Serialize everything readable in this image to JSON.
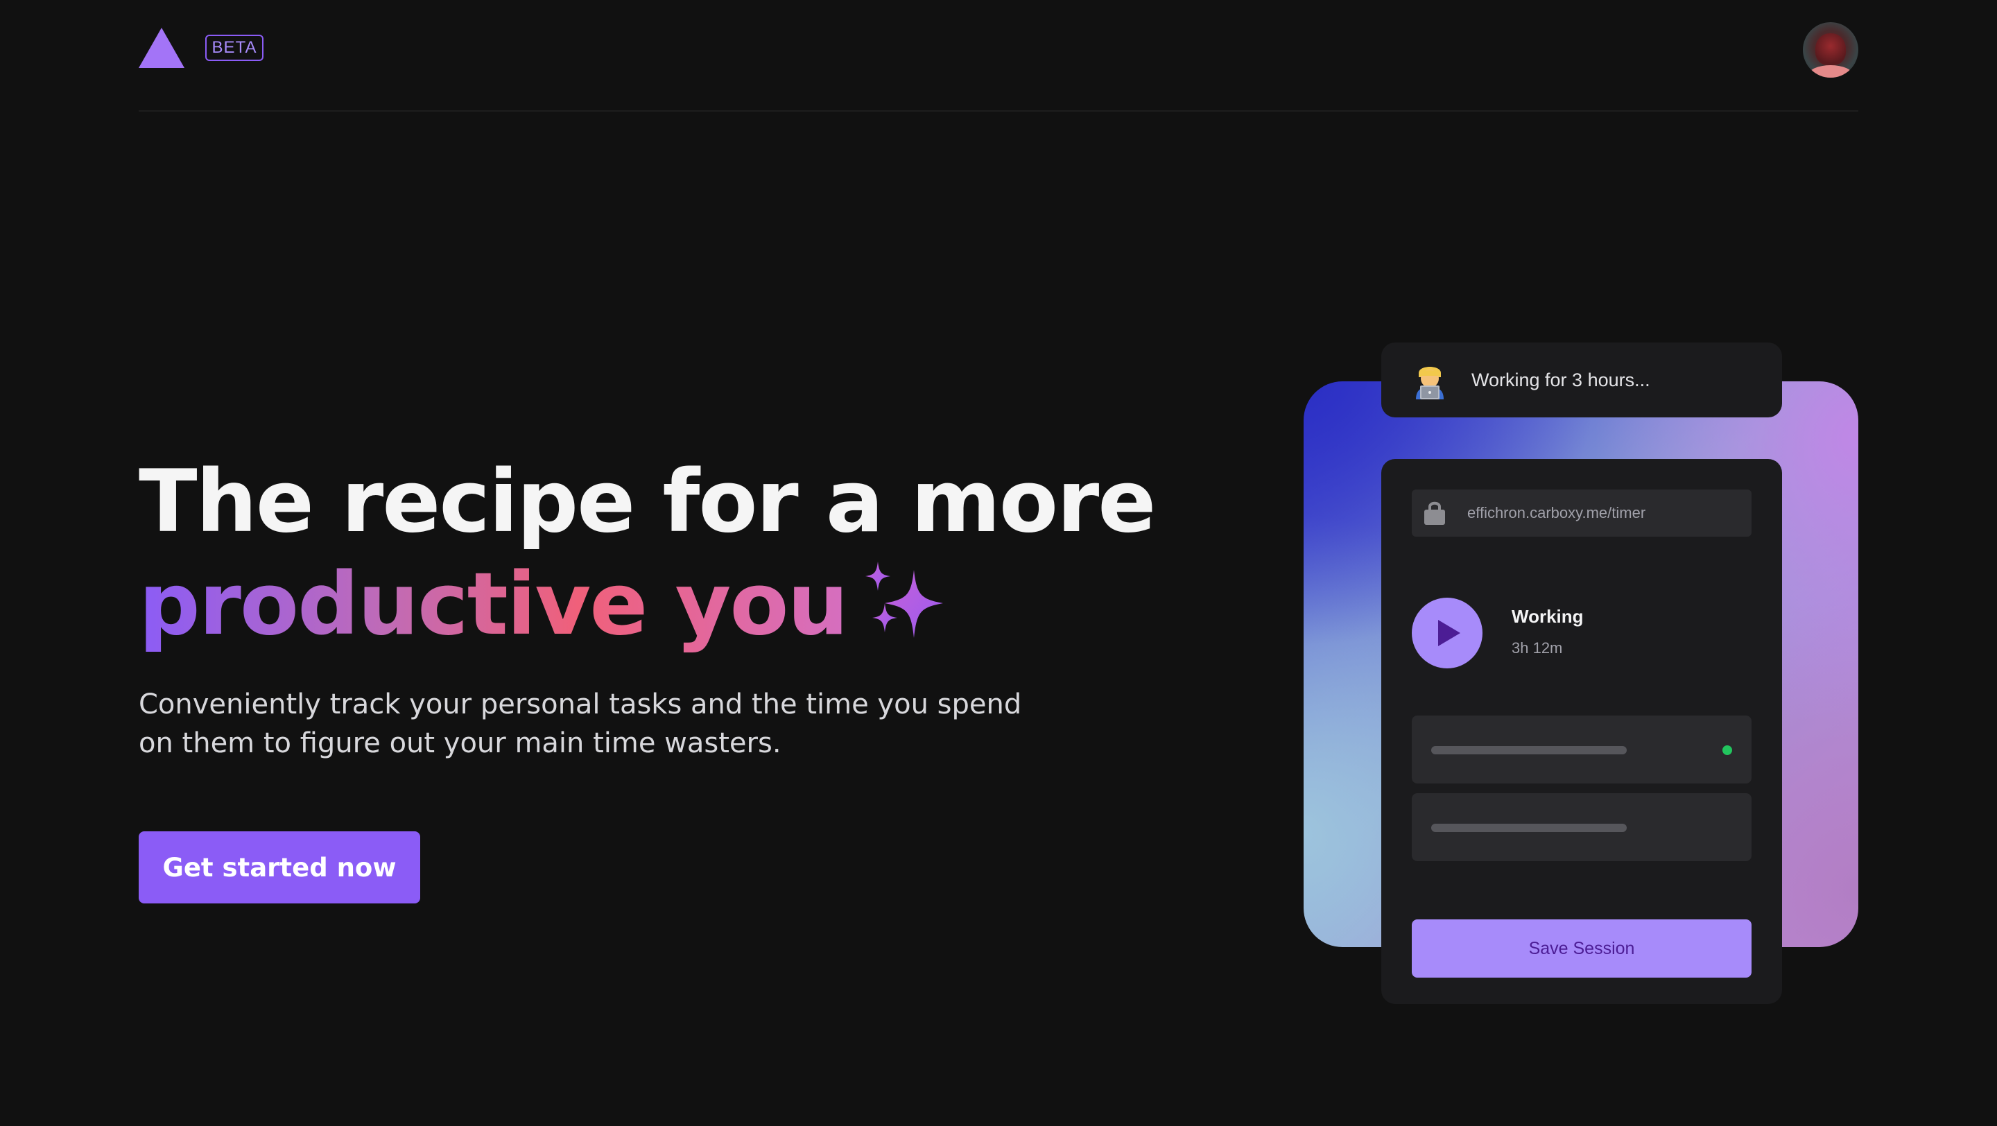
{
  "header": {
    "badge": "BETA",
    "logo_icon": "triangle-logo",
    "avatar_icon": "user-avatar"
  },
  "hero": {
    "title_line1": "The recipe for a more",
    "title_line2": "productive you",
    "sparkle_icon": "sparkles-icon",
    "subtitle": "Conveniently track your personal tasks and the time you spend on them to figure out your main time wasters.",
    "cta_label": "Get started now"
  },
  "illustration": {
    "status_icon": "person-at-laptop-emoji",
    "status_text": "Working for 3 hours...",
    "url_icon": "lock-icon",
    "url": "effichron.carboxy.me/timer",
    "session_title": "Working",
    "session_time": "3h 12m",
    "save_label": "Save Session"
  },
  "colors": {
    "background": "#111111",
    "accent": "#8b5cf6",
    "accent_light": "#a78bfa",
    "status_green": "#22c55e"
  }
}
